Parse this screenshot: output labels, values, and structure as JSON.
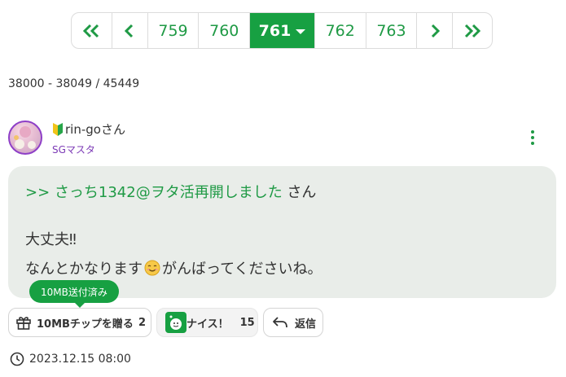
{
  "pagination": {
    "first_icon": "double-chevron-left-icon",
    "prev_icon": "chevron-left-icon",
    "pages": [
      "759",
      "760",
      "761",
      "762",
      "763"
    ],
    "current": "761",
    "next_icon": "chevron-right-icon",
    "last_icon": "double-chevron-right-icon"
  },
  "range_text": "38000 - 38049 / 45449",
  "post": {
    "username": "rin-goさん",
    "beginner_icon": "beginner-leaf-icon",
    "rank": "SGマスタ",
    "reply_to": ">> さっち1342@ヲタ活再開しました",
    "reply_suffix": " さん",
    "line1": "大丈夫‼︎",
    "line2_before": "なんとかなります",
    "line2_emoji": "smiling-face-icon",
    "line2_after": "がんばってくださいね。",
    "tooltip": "10MB送付済み",
    "gift_label": "10MBチップを贈る",
    "gift_count": "2",
    "nice_label": "ナイス！",
    "nice_count": "15",
    "reply_label": "返信",
    "date": "2023.12.15 08:00"
  },
  "colors": {
    "accent": "#17a042",
    "link": "#1f9a45",
    "rank": "#7c3ab6",
    "bubble": "#e9ede9"
  }
}
